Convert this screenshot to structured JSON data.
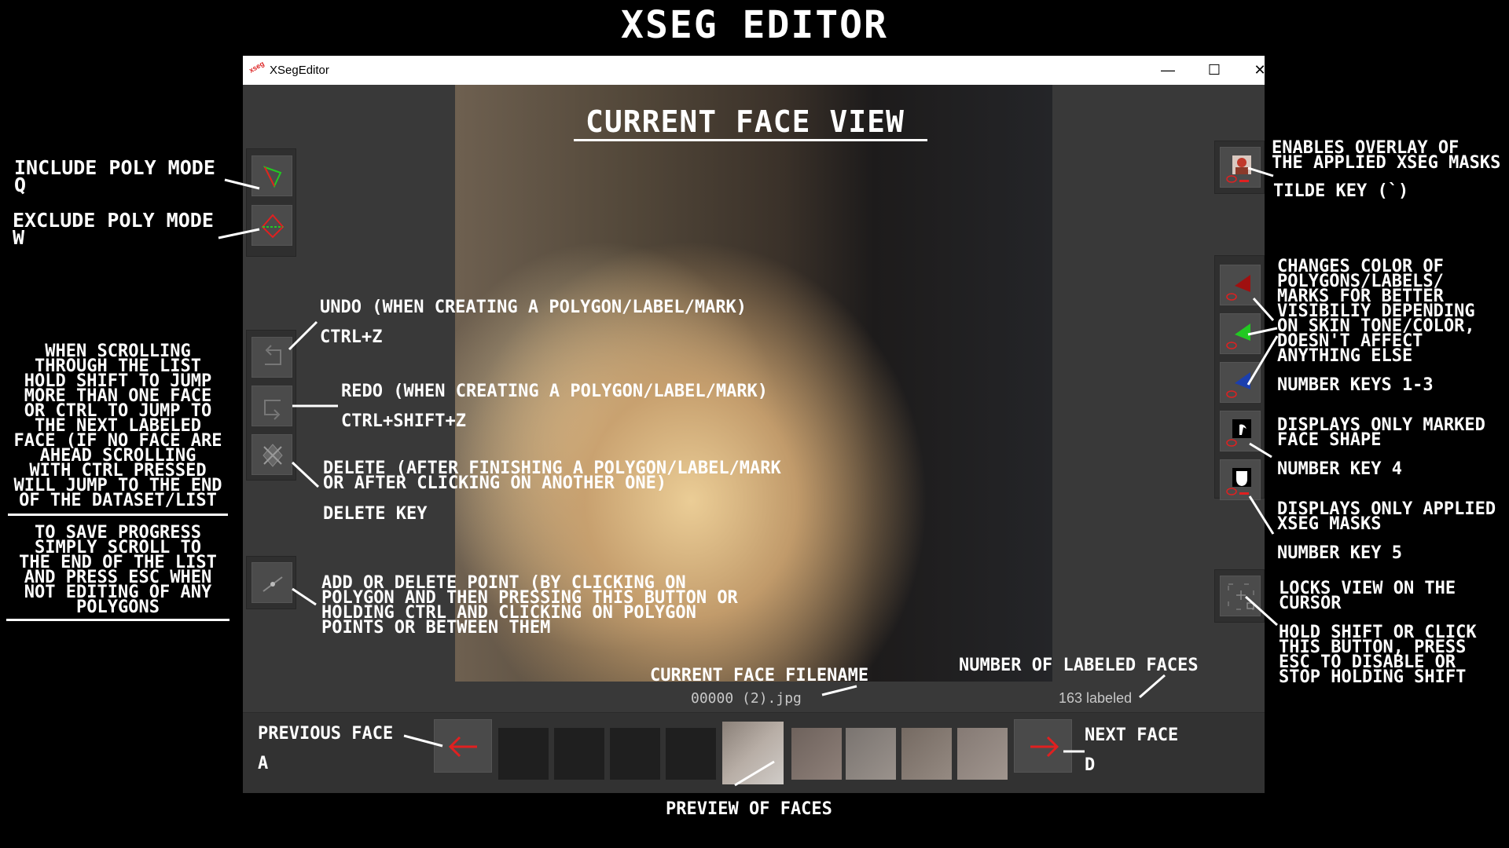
{
  "title": "XSEG EDITOR",
  "window": {
    "title": "XSegEditor",
    "app_icon_text": "xseg",
    "min_symbol": "—",
    "max_symbol": "☐",
    "close_symbol": "✕"
  },
  "view_title": "CURRENT FACE VIEW",
  "status": {
    "filename": "00000 (2).jpg",
    "labeled": "163 labeled"
  },
  "annotations": {
    "include": "INCLUDE POLY MODE\nQ",
    "exclude": "EXCLUDE POLY MODE\nW",
    "scroll": "WHEN SCROLLING\nTHROUGH THE LIST\nHOLD SHIFT TO JUMP\nMORE THAN ONE FACE\nOR CTRL TO JUMP TO\nTHE NEXT LABELED\nFACE (IF NO FACE ARE\nAHEAD SCROLLING\nWITH CTRL PRESSED\nWILL JUMP TO THE END\nOF THE DATASET/LIST",
    "save": "TO SAVE PROGRESS\nSIMPLY SCROLL TO\nTHE END OF THE LIST\nAND PRESS ESC WHEN\nNOT EDITING OF ANY\nPOLYGONS",
    "undo": "UNDO (WHEN CREATING A POLYGON/LABEL/MARK)",
    "undo_key": "CTRL+Z",
    "redo": "REDO (WHEN CREATING A POLYGON/LABEL/MARK)",
    "redo_key": "CTRL+SHIFT+Z",
    "delete": "DELETE (AFTER FINISHING A POLYGON/LABEL/MARK\nOR AFTER CLICKING ON ANOTHER ONE)",
    "delete_key": "DELETE KEY",
    "point": "ADD OR DELETE POINT (BY CLICKING ON\nPOLYGON AND THEN PRESSING THIS BUTTON OR\nHOLDING CTRL AND CLICKING ON POLYGON\nPOINTS OR BETWEEN THEM",
    "filename": "CURRENT FACE FILENAME",
    "labeled": "NUMBER OF LABELED FACES",
    "overlay": "ENABLES OVERLAY OF\nTHE APPLIED XSEG MASKS",
    "overlay_key": "TILDE KEY (`)",
    "color": "CHANGES COLOR OF\nPOLYGONS/LABELS/\nMARKS FOR BETTER\nVISIBILIY DEPENDING\nON SKIN TONE/COLOR,\nDOESN'T AFFECT\nANYTHING ELSE",
    "color_keys": "NUMBER KEYS 1-3",
    "marked": "DISPLAYS ONLY MARKED\nFACE SHAPE",
    "marked_key": "NUMBER KEY 4",
    "applied": "DISPLAYS ONLY APPLIED\nXSEG MASKS",
    "applied_key": "NUMBER KEY 5",
    "lock": "LOCKS VIEW ON THE\nCURSOR",
    "lock_hint": "HOLD SHIFT OR CLICK\nTHIS BUTTON, PRESS\nESC TO DISABLE OR\nSTOP HOLDING SHIFT",
    "prev": "PREVIOUS FACE",
    "prev_key": "A",
    "next": "NEXT FACE",
    "next_key": "D",
    "preview": "PREVIEW OF FACES"
  },
  "icons": {
    "include": "include-poly-icon",
    "exclude": "exclude-poly-icon",
    "undo": "undo-icon",
    "redo": "redo-icon",
    "delete": "delete-poly-icon",
    "point": "add-point-icon",
    "overlay": "overlay-mask-icon",
    "color_red": "red-color-icon",
    "color_green": "green-color-icon",
    "color_blue": "blue-color-icon",
    "marked": "marked-shape-icon",
    "applied": "applied-mask-icon",
    "lock": "view-lock-icon"
  },
  "colors": {
    "accent_red": "#e02020",
    "poly_green": "#22c922",
    "poly_blue": "#1b3fae",
    "poly_red": "#b01010"
  }
}
